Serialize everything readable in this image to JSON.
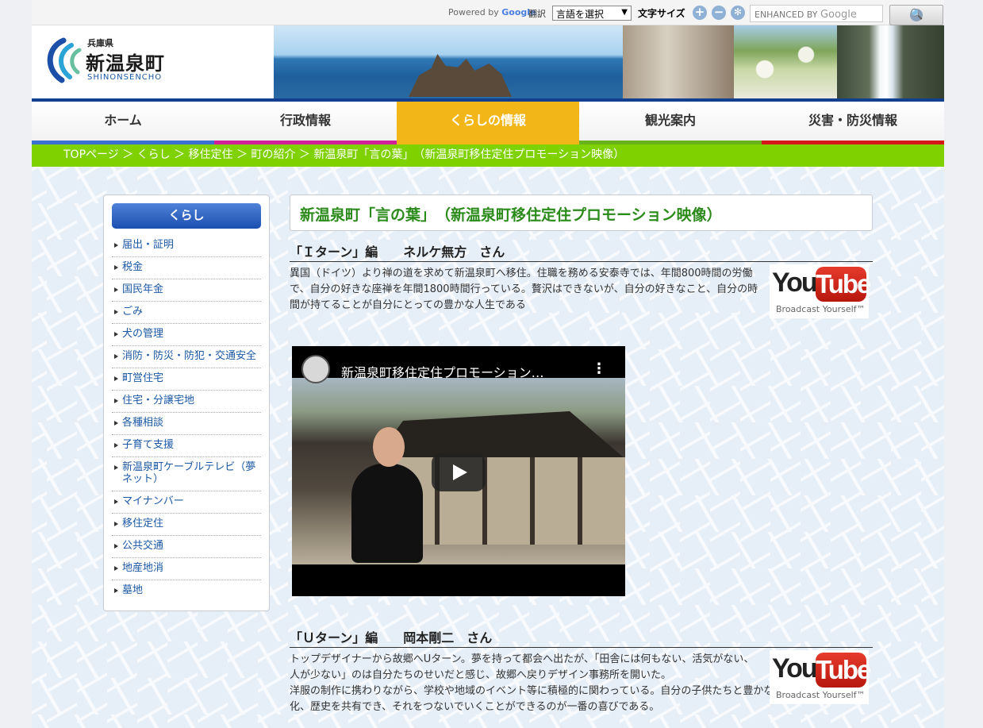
{
  "topbar": {
    "powered_by": "Powered by",
    "google": "Google",
    "translate_label": "翻訳",
    "language_select": "言語を選択",
    "font_size_label": "文字サイズ",
    "font_increase": "+",
    "font_decrease": "−",
    "font_reset": "✻",
    "search_placeholder": "ENHANCED BY",
    "search_google": "Google",
    "search_button": "🔍"
  },
  "header": {
    "prefecture": "兵庫県",
    "town_name": "新温泉町",
    "romanized": "SHINONSENCHO"
  },
  "nav": [
    {
      "label": "ホーム",
      "color": "#3b6fd1"
    },
    {
      "label": "行政情報",
      "color": "#d0219a"
    },
    {
      "label": "くらしの情報",
      "color": "#f3b619"
    },
    {
      "label": "観光案内",
      "color": "#6ab21c"
    },
    {
      "label": "災害・防災情報",
      "color": "#d41818"
    }
  ],
  "breadcrumb": [
    "TOPページ",
    "＞",
    "くらし",
    "＞",
    "移住定住",
    "＞",
    "町の紹介",
    "＞",
    "新温泉町「言の葉」　（新温泉町移住定住プロモーション映像）"
  ],
  "sidebar": {
    "title": "くらし",
    "items": [
      "届出・証明",
      "税金",
      "国民年金",
      "ごみ",
      "犬の管理",
      "消防・防災・防犯・交通安全",
      "町営住宅",
      "住宅・分譲宅地",
      "各種相談",
      "子育て支援",
      "新温泉町ケーブルテレビ（夢ネット）",
      "マイナンバー",
      "移住定住",
      "公共交通",
      "地産地消",
      "墓地"
    ]
  },
  "main": {
    "title": "新温泉町「言の葉」　（新温泉町移住定住プロモーション映像）",
    "section1": {
      "heading": "「Ｉターン」編　　ネルケ無方　さん",
      "text": "異国（ドイツ）より禅の道を求めて新温泉町へ移住。住職を務める安泰寺では、年間800時間の労働で、自分の好きな座禅を年間1800時間行っている。贅沢はできないが、自分の好きなこと、自分の時間が持てることが自分にとっての豊かな人生である"
    },
    "video": {
      "title": "新温泉町移住定住プロモーション…",
      "menu": "⋮"
    },
    "section2": {
      "heading": "「Ｕターン」編　　岡本剛二　さん",
      "text1": "トップデザイナーから故郷へUターン。夢を持って都会へ出たが、「田舎には何もない、活気がない、人が少ない」のは自分たちのせいだと感じ、故郷へ戻りデザイン事務所を開いた。",
      "text2": "洋服の制作に携わりながら、学校や地域のイベント等に積極的に関わっている。自分の子供たちと豊かな自然や文化、歴史を共有でき、それをつないでいくことができるのが一番の喜びである。"
    },
    "youtube": {
      "you": "You",
      "tube": "Tube",
      "tagline": "Broadcast Yourself™"
    }
  }
}
